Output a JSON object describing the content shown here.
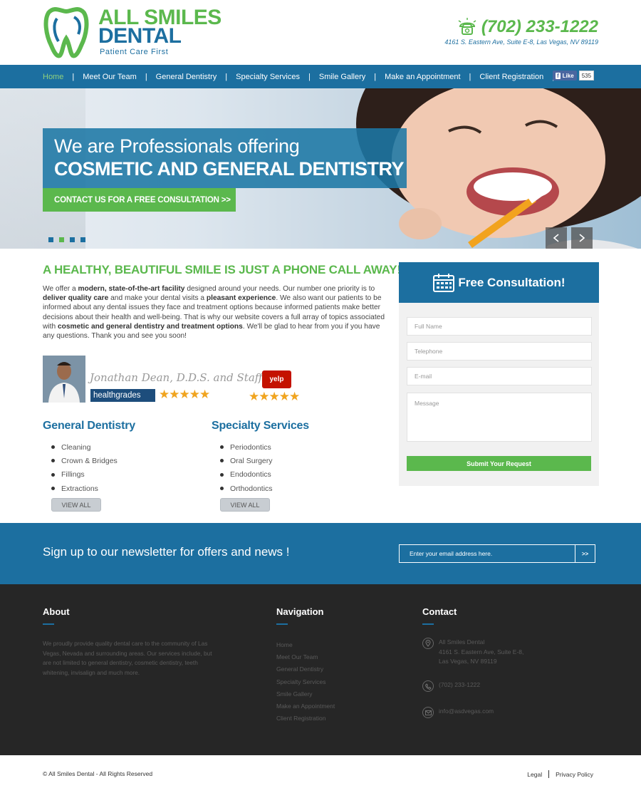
{
  "brand": {
    "line1": "ALL SMILES",
    "line2": "DENTAL",
    "tagline": "Patient Care First",
    "green": "#5bb84d",
    "blue": "#1c6fa0"
  },
  "contact_top": {
    "phone": "(702) 233-1222",
    "address": "4161 S. Eastern Ave, Suite E-8, Las Vegas, NV 89119"
  },
  "nav": {
    "items": [
      "Home",
      "Meet Our Team",
      "General Dentistry",
      "Specialty Services",
      "Smile Gallery",
      "Make an Appointment",
      "Client Registration"
    ],
    "active": "Home"
  },
  "facebook": {
    "like_label": "Like",
    "count": "535"
  },
  "hero": {
    "line1": "We are Professionals offering",
    "line2": "COSMETIC AND GENERAL DENTISTRY",
    "cta": "CONTACT US FOR A FREE CONSULTATION >>",
    "prev_icon": "chevron-left-icon",
    "next_icon": "chevron-right-icon",
    "slide_count": 4,
    "active_slide": 2
  },
  "intro": {
    "headline": "A HEALTHY, BEAUTIFUL SMILE IS JUST A PHONE CALL AWAY!",
    "parts": [
      {
        "t": "We offer a ",
        "b": false
      },
      {
        "t": "modern, state-of-the-art facility",
        "b": true
      },
      {
        "t": " designed around your needs. Our number one priority is to ",
        "b": false
      },
      {
        "t": "deliver quality care",
        "b": true
      },
      {
        "t": " and make your dental visits a ",
        "b": false
      },
      {
        "t": "pleasant experience",
        "b": true
      },
      {
        "t": ". We also want our patients to be informed about any dental issues they face and treatment options because informed patients make better decisions about their health and well-being. That is why our website covers a full array of topics associated with ",
        "b": false
      },
      {
        "t": "cosmetic and general dentistry and treatment options",
        "b": true
      },
      {
        "t": ". We'll be glad to hear from you if you have any questions. Thank you and see you soon!",
        "b": false
      }
    ]
  },
  "reviews": {
    "signature": "Jonathan Dean, D.D.S. and Staff",
    "healthgrades_label": "healthgrades",
    "healthgrades_stars": "★★★★★",
    "yelp_label": "yelp",
    "yelp_stars": "★★★★★"
  },
  "services": {
    "general": {
      "title": "General Dentistry",
      "items": [
        "Cleaning",
        "Crown & Bridges",
        "Fillings",
        "Extractions"
      ],
      "view_all": "VIEW ALL"
    },
    "specialty": {
      "title": "Specialty Services",
      "items": [
        "Periodontics",
        "Oral Surgery",
        "Endodontics",
        "Orthodontics"
      ],
      "view_all": "VIEW ALL"
    }
  },
  "consult": {
    "title": "Free Consultation!",
    "fields": [
      "Full Name",
      "Telephone",
      "E-mail",
      "Message"
    ],
    "submit": "Submit Your Request"
  },
  "newsletter": {
    "text": "Sign up to our newsletter for offers and news !",
    "placeholder": "Enter your email address here.",
    "button": ">>"
  },
  "footer": {
    "about_title": "About",
    "about_text": "We proudly provide quality dental care to the community of Las Vegas, Nevada and surrounding areas. Our services include, but are not limited to general dentistry, cosmetic dentistry, teeth whitening, invisalign and much more.",
    "nav_title": "Navigation",
    "nav_items": [
      "Home",
      "Meet Our Team",
      "General Dentistry",
      "Specialty Services",
      "Smile Gallery",
      "Make an Appointment",
      "Client Registration"
    ],
    "contact_title": "Contact",
    "contact_name": "All Smiles Dental",
    "contact_street": "4161 S. Eastern Ave, Suite E-8,",
    "contact_city": "Las Vegas, NV 89119",
    "contact_phone": "(702) 233-1222",
    "contact_email": "info@asdvegas.com"
  },
  "bottom": {
    "copyright": "© All Smiles Dental - All Rights Reserved",
    "legal": "Legal",
    "privacy": "Privacy Policy"
  }
}
